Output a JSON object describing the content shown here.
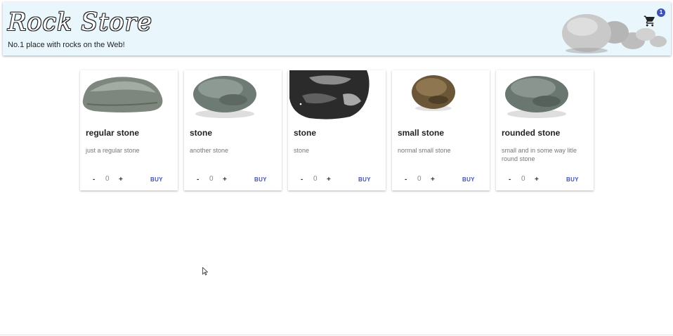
{
  "header": {
    "logo_text": "Rock Store",
    "tagline": "No.1 place with rocks on the Web!",
    "cart_count": "1",
    "cart_icon": "shopping-cart-icon"
  },
  "colors": {
    "header_bg": "#e9f7fd",
    "accent": "#3f51b5"
  },
  "products": [
    {
      "title": "regular stone",
      "description": "just a regular stone",
      "quantity": "0",
      "minus": "-",
      "plus": "+",
      "buy": "BUY"
    },
    {
      "title": "stone",
      "description": "another stone",
      "quantity": "0",
      "minus": "-",
      "plus": "+",
      "buy": "BUY"
    },
    {
      "title": "stone",
      "description": "stone",
      "quantity": "0",
      "minus": "-",
      "plus": "+",
      "buy": "BUY"
    },
    {
      "title": "small stone",
      "description": "normal small stone",
      "quantity": "0",
      "minus": "-",
      "plus": "+",
      "buy": "BUY"
    },
    {
      "title": "rounded stone",
      "description": "small and in some way litle round stone",
      "quantity": "0",
      "minus": "-",
      "plus": "+",
      "buy": "BUY"
    }
  ]
}
